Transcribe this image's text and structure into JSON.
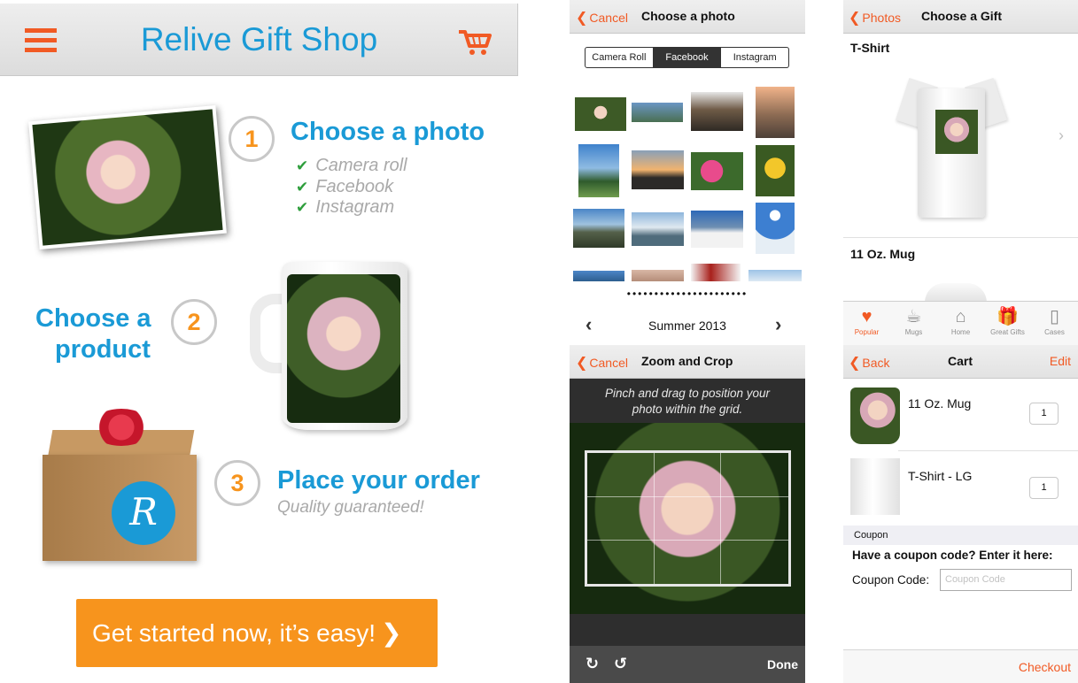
{
  "left": {
    "title": "Relive Gift Shop",
    "step1": {
      "number": "1",
      "title": "Choose a photo",
      "options": [
        "Camera roll",
        "Facebook",
        "Instagram"
      ]
    },
    "step2": {
      "number": "2",
      "title_line1": "Choose a",
      "title_line2": "product"
    },
    "step3": {
      "number": "3",
      "title": "Place your order",
      "subtitle": "Quality guaranteed!"
    },
    "box_logo": "R",
    "cta": "Get started now, it’s easy!",
    "colors": {
      "accent": "#f7941d",
      "brand_blue": "#1a9ad6",
      "icon_orange": "#f15a24"
    }
  },
  "choose_photo": {
    "back": "Cancel",
    "title": "Choose a photo",
    "segments": [
      "Camera Roll",
      "Facebook",
      "Instagram"
    ],
    "selected_segment": "Facebook",
    "album": "Summer 2013"
  },
  "zoom_crop": {
    "back": "Cancel",
    "title": "Zoom and Crop",
    "hint_line1": "Pinch and drag to position your",
    "hint_line2": "photo within the grid.",
    "done": "Done"
  },
  "choose_gift": {
    "back": "Photos",
    "title": "Choose a Gift",
    "items": [
      "T-Shirt",
      "11 Oz. Mug"
    ],
    "tabs": [
      "Popular",
      "Mugs",
      "Home",
      "Great Gifts",
      "Cases"
    ],
    "active_tab": "Popular"
  },
  "cart": {
    "back": "Back",
    "title": "Cart",
    "edit": "Edit",
    "items": [
      {
        "name": "11 Oz. Mug",
        "qty": "1"
      },
      {
        "name": "T-Shirt - LG",
        "qty": "1"
      }
    ],
    "coupon_section": "Coupon",
    "coupon_question": "Have a coupon code? Enter it here:",
    "coupon_label": "Coupon Code:",
    "coupon_placeholder": "Coupon Code",
    "checkout": "Checkout"
  }
}
